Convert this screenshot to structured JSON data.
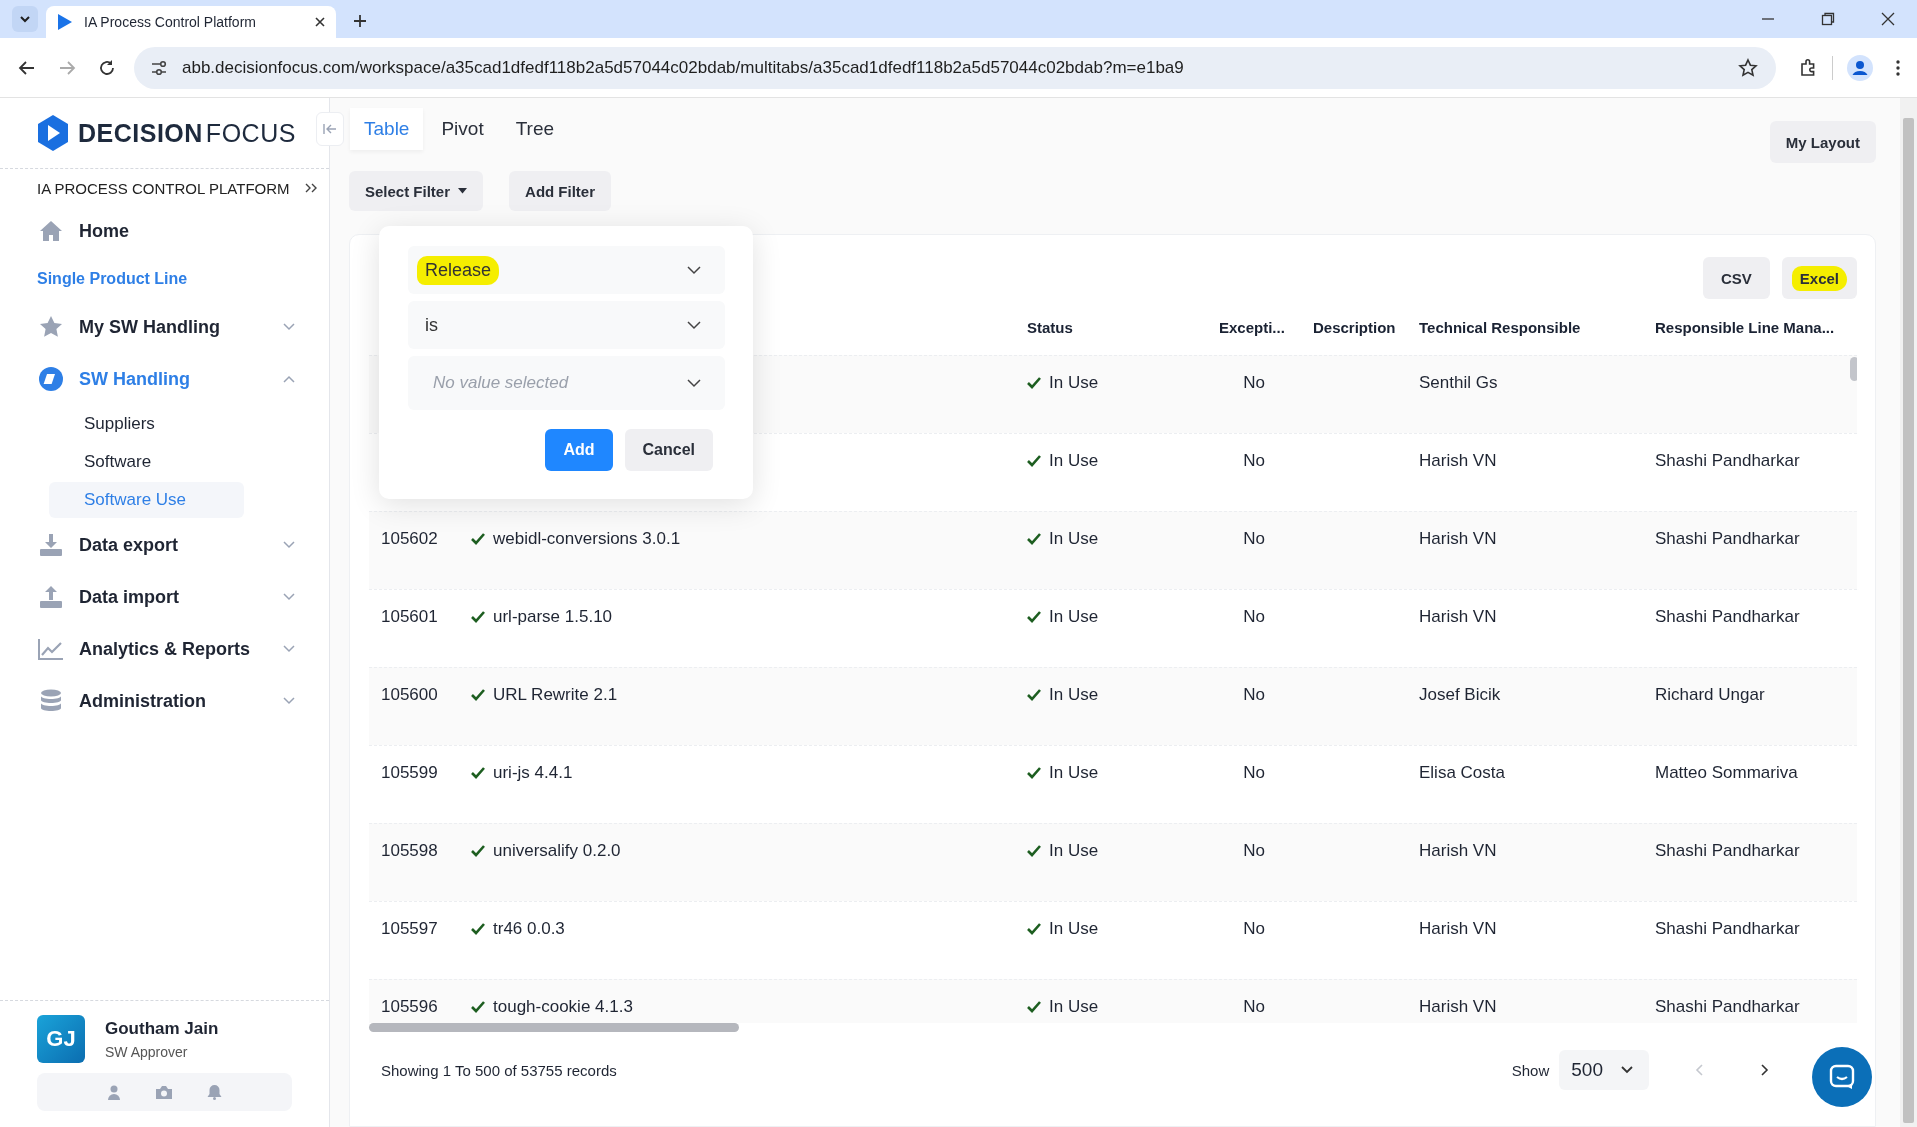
{
  "browser": {
    "tab_title": "IA Process Control Platform",
    "url": "abb.decisionfocus.com/workspace/a35cad1dfedf118b2a5d57044c02bdab/multitabs/a35cad1dfedf118b2a5d57044c02bdab?m=e1ba9"
  },
  "sidebar": {
    "brand_bold": "DECISION",
    "brand_light": "FOCUS",
    "platform": "IA PROCESS CONTROL PLATFORM",
    "items": [
      {
        "kind": "link",
        "label": "Home",
        "selected": false
      },
      {
        "kind": "section",
        "label": "Single Product Line"
      },
      {
        "kind": "group",
        "label": "My SW Handling",
        "selected": false,
        "expanded": false
      },
      {
        "kind": "group",
        "label": "SW Handling",
        "selected": true,
        "expanded": true,
        "children": [
          {
            "label": "Suppliers",
            "selected": false
          },
          {
            "label": "Software",
            "selected": false
          },
          {
            "label": "Software Use",
            "selected": true
          }
        ]
      },
      {
        "kind": "group",
        "label": "Data export",
        "selected": false,
        "expanded": false
      },
      {
        "kind": "group",
        "label": "Data import",
        "selected": false,
        "expanded": false
      },
      {
        "kind": "group",
        "label": "Analytics & Reports",
        "selected": false,
        "expanded": false
      },
      {
        "kind": "group",
        "label": "Administration",
        "selected": false,
        "expanded": false
      }
    ],
    "user": {
      "initials": "GJ",
      "name": "Goutham Jain",
      "role": "SW Approver"
    }
  },
  "view_tabs": [
    {
      "label": "Table",
      "selected": true
    },
    {
      "label": "Pivot",
      "selected": false
    },
    {
      "label": "Tree",
      "selected": false
    }
  ],
  "filter_buttons": [
    {
      "label": "Select Filter",
      "kind": "dropdown"
    },
    {
      "label": "Add Filter",
      "kind": "plain"
    }
  ],
  "layout_button": "My Layout",
  "export_buttons": [
    {
      "label": "CSV",
      "highlighted": false
    },
    {
      "label": "Excel",
      "highlighted": true
    }
  ],
  "filter_popup": {
    "fields": [
      {
        "value": "Release",
        "highlighted": true
      },
      {
        "value": "is",
        "highlighted": false
      },
      {
        "placeholder": "No value selected"
      }
    ],
    "buttons": [
      {
        "label": "Add",
        "kind": "primary"
      },
      {
        "label": "Cancel",
        "kind": "secondary"
      }
    ]
  },
  "table": {
    "columns": [
      "Status",
      "Excepti...",
      "Description",
      "Technical Responsible",
      "Responsible Line Mana..."
    ],
    "rows": [
      {
        "status": "In Use",
        "exception": "No",
        "technical_responsible": "Senthil Gs"
      },
      {
        "status": "In Use",
        "exception": "No",
        "technical_responsible": "Harish VN",
        "line_manager": "Shashi Pandharkar"
      },
      {
        "id": "105602",
        "name": "webidl-conversions 3.0.1",
        "status": "In Use",
        "exception": "No",
        "technical_responsible": "Harish VN",
        "line_manager": "Shashi Pandharkar"
      },
      {
        "id": "105601",
        "name": "url-parse 1.5.10",
        "status": "In Use",
        "exception": "No",
        "technical_responsible": "Harish VN",
        "line_manager": "Shashi Pandharkar"
      },
      {
        "id": "105600",
        "name": "URL Rewrite 2.1",
        "status": "In Use",
        "exception": "No",
        "technical_responsible": "Josef Bicik",
        "line_manager": "Richard Ungar"
      },
      {
        "id": "105599",
        "name": "uri-js 4.4.1",
        "status": "In Use",
        "exception": "No",
        "technical_responsible": "Elisa Costa",
        "line_manager": "Matteo Sommariva"
      },
      {
        "id": "105598",
        "name": "universalify 0.2.0",
        "status": "In Use",
        "exception": "No",
        "technical_responsible": "Harish VN",
        "line_manager": "Shashi Pandharkar"
      },
      {
        "id": "105597",
        "name": "tr46 0.0.3",
        "status": "In Use",
        "exception": "No",
        "technical_responsible": "Harish VN",
        "line_manager": "Shashi Pandharkar"
      },
      {
        "id": "105596",
        "name": "tough-cookie 4.1.3",
        "status": "In Use",
        "exception": "No",
        "technical_responsible": "Harish VN",
        "line_manager": "Shashi Pandharkar"
      }
    ]
  },
  "footer": {
    "summary": "Showing 1 To 500 of 53755 records",
    "show_label": "Show",
    "page_size": "500",
    "prev_disabled": true,
    "next_disabled": false
  }
}
